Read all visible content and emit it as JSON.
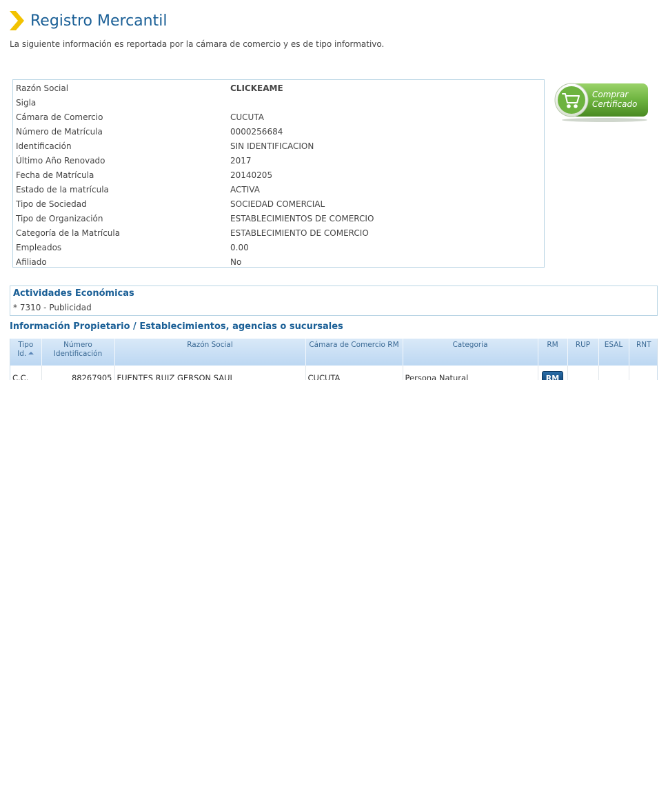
{
  "header": {
    "title": "Registro Mercantil",
    "subtitle": "La siguiente información es reportada por la cámara de comercio y es de tipo informativo."
  },
  "info": {
    "rows": [
      {
        "label": "Razón Social",
        "value": "CLICKEAME"
      },
      {
        "label": "Sigla",
        "value": ""
      },
      {
        "label": "Cámara de Comercio",
        "value": "CUCUTA"
      },
      {
        "label": "Número de Matrícula",
        "value": "0000256684"
      },
      {
        "label": "Identificación",
        "value": "SIN IDENTIFICACION"
      },
      {
        "label": "Último Año Renovado",
        "value": "2017"
      },
      {
        "label": "Fecha de Matrícula",
        "value": "20140205"
      },
      {
        "label": "Estado de la matrícula",
        "value": "ACTIVA"
      },
      {
        "label": "Tipo de Sociedad",
        "value": "SOCIEDAD COMERCIAL"
      },
      {
        "label": "Tipo de Organización",
        "value": "ESTABLECIMIENTOS DE COMERCIO"
      },
      {
        "label": "Categoría de la Matrícula",
        "value": "ESTABLECIMIENTO DE COMERCIO"
      },
      {
        "label": "Empleados",
        "value": "0.00"
      },
      {
        "label": "Afiliado",
        "value": "No"
      }
    ]
  },
  "buy_button": {
    "line1": "Comprar",
    "line2": "Certificado",
    "color": "#6db33f"
  },
  "activities": {
    "title": "Actividades Económicas",
    "items": [
      "* 7310 - Publicidad"
    ]
  },
  "owners": {
    "title": "Información Propietario / Establecimientos, agencias o sucursales",
    "columns": {
      "tipo_l1": "Tipo",
      "tipo_l2": "Id.",
      "numero_l1": "Número",
      "numero_l2": "Identificación",
      "razon": "Razón Social",
      "camara": "Cámara de Comercio RM",
      "categoria": "Categoria",
      "rm": "RM",
      "rup": "RUP",
      "esal": "ESAL",
      "rnt": "RNT"
    },
    "rows": [
      {
        "tipo": "C.C.",
        "numero": "88267905",
        "razon": "FUENTES RUIZ GERSON SAUL",
        "camara": "CUCUTA",
        "categoria": "Persona Natural",
        "rm_button": "RM"
      }
    ]
  },
  "colors": {
    "title": "#1a5f96",
    "accent_diamond": "#f2c200",
    "border": "#b8d4e4",
    "grid_header": "#bcd7f2",
    "rm_button": "#0e3f6e"
  }
}
